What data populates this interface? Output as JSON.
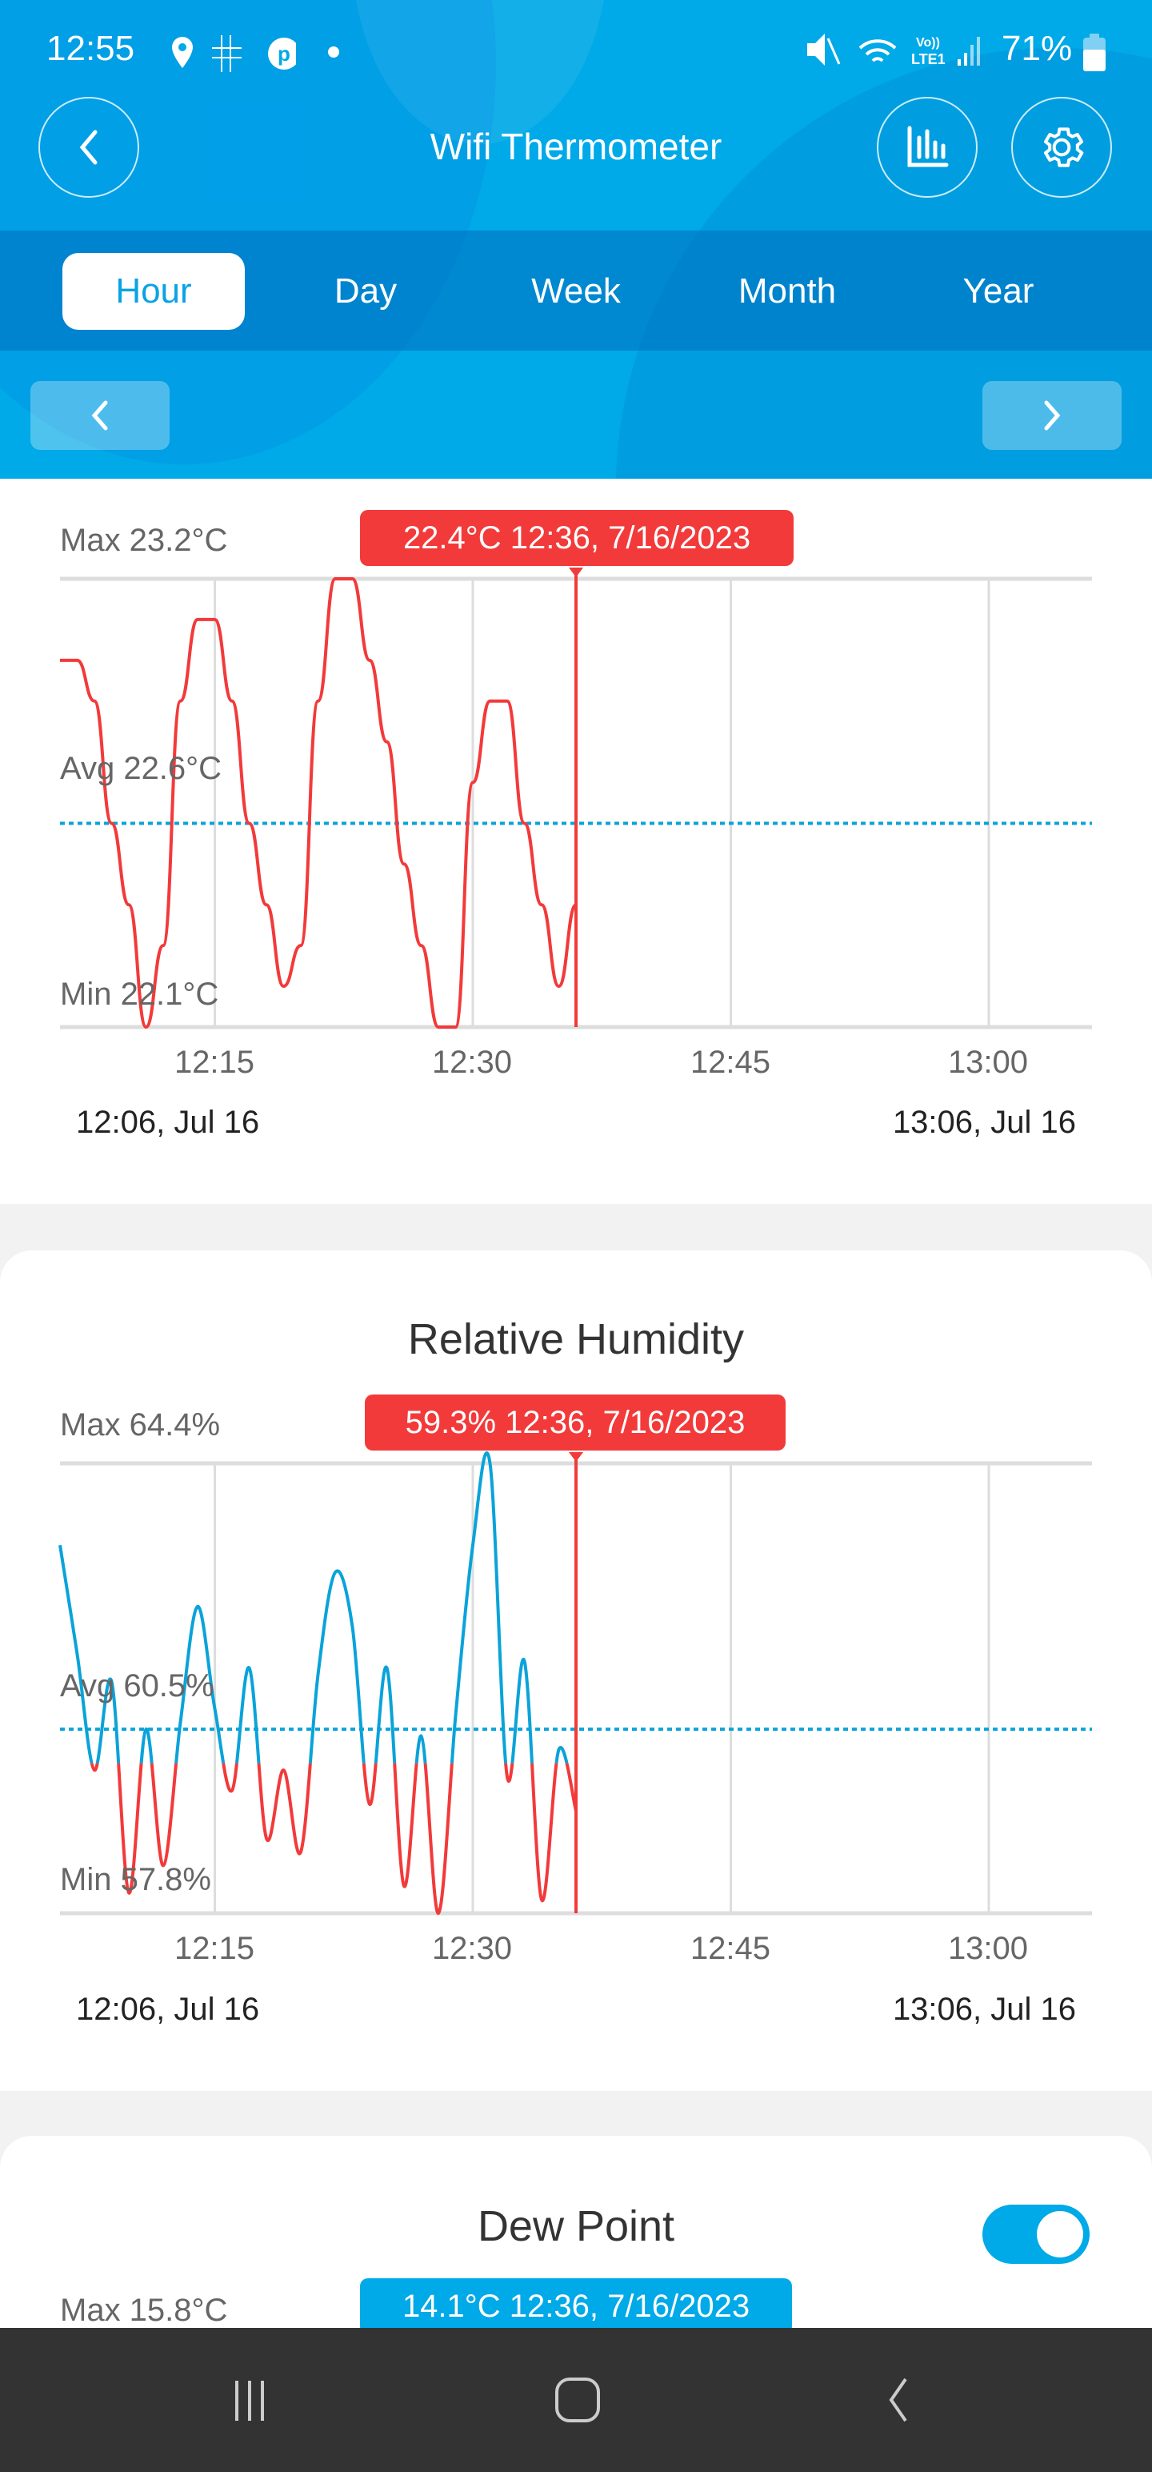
{
  "status_bar": {
    "time": "12:55",
    "battery": "71%",
    "network": "LTE1",
    "icons": [
      "location-icon",
      "tic-tac-toe-icon",
      "pinterest-icon",
      "dot-icon",
      "mute-icon",
      "wifi-icon",
      "volte-icon",
      "signal-icon",
      "battery-icon"
    ]
  },
  "header": {
    "title": "Wifi Thermometer",
    "back_icon": "chevron-left-icon",
    "chart_icon": "bar-chart-icon",
    "settings_icon": "gear-icon"
  },
  "tabs": [
    {
      "label": "Hour",
      "active": true
    },
    {
      "label": "Day"
    },
    {
      "label": "Week"
    },
    {
      "label": "Month"
    },
    {
      "label": "Year"
    }
  ],
  "colors": {
    "brand": "#00a9e7",
    "line_red": "#f23a3a",
    "line_blue": "#0aa3d9",
    "grid": "#dddddd"
  },
  "temperature": {
    "max": "Max 23.2°C",
    "avg": "Avg 22.6°C",
    "min": "Min 22.1°C",
    "tooltip": "22.4°C 12:36, 7/16/2023",
    "ticks": [
      "12:15",
      "12:30",
      "12:45",
      "13:00"
    ],
    "start": "12:06, Jul 16",
    "end": "13:06, Jul 16"
  },
  "humidity": {
    "title": "Relative Humidity",
    "max": "Max 64.4%",
    "avg": "Avg 60.5%",
    "min": "Min 57.8%",
    "tooltip": "59.3% 12:36, 7/16/2023",
    "ticks": [
      "12:15",
      "12:30",
      "12:45",
      "13:00"
    ],
    "start": "12:06, Jul 16",
    "end": "13:06, Jul 16"
  },
  "dew_point": {
    "title": "Dew Point",
    "toggle_on": true,
    "max": "Max 15.8°C",
    "tooltip": "14.1°C 12:36, 7/16/2023"
  },
  "chart_data": [
    {
      "type": "line",
      "xlabel": "",
      "ylabel": "",
      "x_range": [
        "12:06",
        "13:06"
      ],
      "ylim": [
        22.1,
        23.2
      ],
      "avg": 22.6,
      "cursor": "12:36",
      "x": [
        "12:06",
        "12:07",
        "12:08",
        "12:09",
        "12:10",
        "12:11",
        "12:12",
        "12:13",
        "12:14",
        "12:15",
        "12:16",
        "12:17",
        "12:18",
        "12:19",
        "12:20",
        "12:21",
        "12:22",
        "12:23",
        "12:24",
        "12:25",
        "12:26",
        "12:27",
        "12:28",
        "12:29",
        "12:30",
        "12:31",
        "12:32",
        "12:33",
        "12:34",
        "12:35",
        "12:36"
      ],
      "values": [
        23.0,
        23.0,
        22.9,
        22.6,
        22.4,
        22.1,
        22.3,
        22.9,
        23.1,
        23.1,
        22.9,
        22.6,
        22.4,
        22.2,
        22.3,
        22.9,
        23.2,
        23.2,
        23.0,
        22.8,
        22.5,
        22.3,
        22.1,
        22.1,
        22.7,
        22.9,
        22.9,
        22.6,
        22.4,
        22.2,
        22.4
      ]
    },
    {
      "type": "line",
      "xlabel": "",
      "ylabel": "",
      "x_range": [
        "12:06",
        "13:06"
      ],
      "ylim": [
        57.8,
        64.4
      ],
      "avg": 60.5,
      "threshold": 60.0,
      "cursor": "12:36",
      "x": [
        "12:06",
        "12:07",
        "12:08",
        "12:09",
        "12:10",
        "12:11",
        "12:12",
        "12:13",
        "12:14",
        "12:15",
        "12:16",
        "12:17",
        "12:18",
        "12:19",
        "12:20",
        "12:21",
        "12:22",
        "12:23",
        "12:24",
        "12:25",
        "12:26",
        "12:27",
        "12:28",
        "12:29",
        "12:30",
        "12:31",
        "12:32",
        "12:33",
        "12:34",
        "12:35",
        "12:36"
      ],
      "values": [
        63.2,
        61.6,
        59.9,
        61.2,
        58.1,
        60.5,
        58.5,
        60.6,
        62.3,
        60.8,
        59.6,
        61.4,
        58.9,
        59.9,
        58.7,
        61.3,
        62.8,
        62.0,
        59.4,
        61.4,
        58.2,
        60.4,
        57.8,
        60.7,
        63.2,
        64.4,
        59.8,
        61.5,
        58.0,
        60.2,
        59.3
      ]
    }
  ],
  "system_nav": {
    "recent": "recent-apps-icon",
    "home": "home-icon",
    "back": "back-icon"
  }
}
